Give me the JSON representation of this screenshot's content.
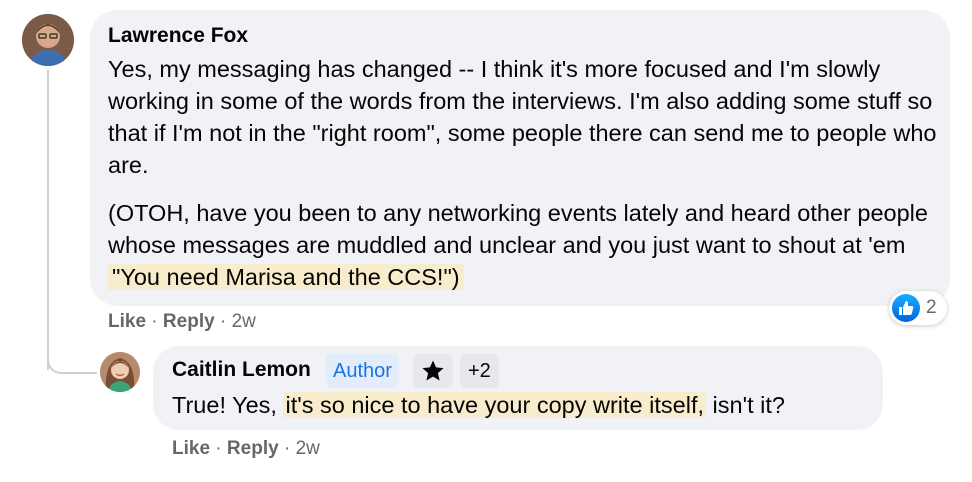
{
  "comment": {
    "author": "Lawrence Fox",
    "paragraph1": "Yes, my messaging has changed -- I think it's more focused and I'm slowly working in some of the words from the interviews. I'm also adding some stuff so that if I'm not in the \"right room\", some people there can send me to people who are.",
    "paragraph2_plain": "(OTOH, have you been to any networking events lately and heard other people whose messages are muddled and unclear and you just want to shout at 'em ",
    "paragraph2_highlight": "\"You need Marisa and the CCS!\")",
    "actions": {
      "like": "Like",
      "reply": "Reply",
      "age": "2w"
    },
    "reaction": {
      "icon": "like-icon",
      "count": "2",
      "color": "#1877f2"
    }
  },
  "reply": {
    "author": "Caitlin Lemon",
    "author_badge": "Author",
    "star_badge_icon": "star-icon",
    "extra_badges": "+2",
    "text_before": "True! Yes, ",
    "text_highlight": "it's so nice to have your copy write itself,",
    "text_after": " isn't it?",
    "actions": {
      "like": "Like",
      "reply": "Reply",
      "age": "2w"
    }
  },
  "colors": {
    "bubble": "#f0f2f5",
    "highlight": "#f7edcc",
    "author_badge_bg": "#e3ecfa",
    "author_badge_text": "#1b74e4",
    "muted_text": "#65676b"
  }
}
